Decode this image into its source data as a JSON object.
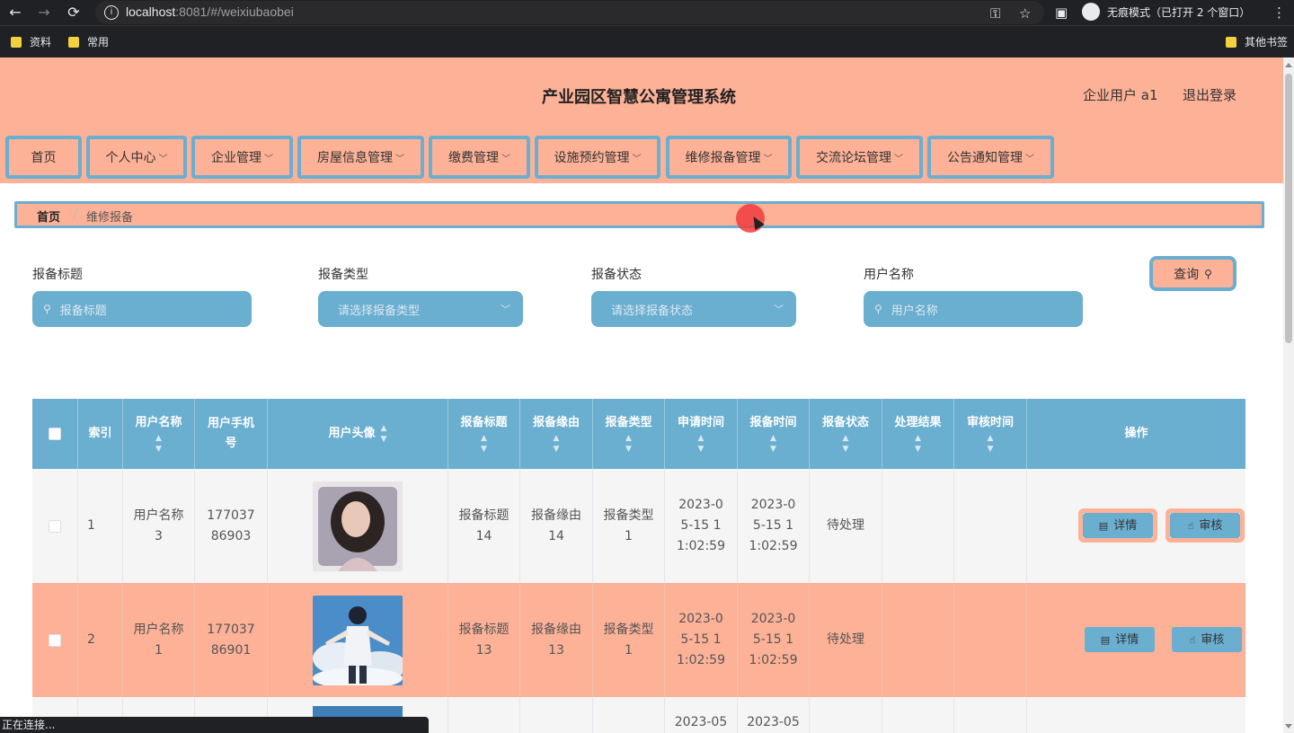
{
  "browser": {
    "url_host": "localhost",
    "url_rest": ":8081/#/weixiubaobei",
    "incognito_label": "无痕模式（已打开 2 个窗口）",
    "bookmarks": [
      "资料",
      "常用"
    ],
    "other_bookmarks": "其他书签",
    "status_text": "正在连接..."
  },
  "header": {
    "title": "产业园区智慧公寓管理系统",
    "user": "企业用户 a1",
    "logout": "退出登录"
  },
  "menu": [
    {
      "label": "首页"
    },
    {
      "label": "个人中心"
    },
    {
      "label": "企业管理"
    },
    {
      "label": "房屋信息管理"
    },
    {
      "label": "缴费管理"
    },
    {
      "label": "设施预约管理"
    },
    {
      "label": "维修报备管理"
    },
    {
      "label": "交流论坛管理"
    },
    {
      "label": "公告通知管理"
    }
  ],
  "breadcrumb": {
    "home": "首页",
    "current": "维修报备"
  },
  "search": {
    "title_label": "报备标题",
    "title_placeholder": "报备标题",
    "type_label": "报备类型",
    "type_placeholder": "请选择报备类型",
    "status_label": "报备状态",
    "status_placeholder": "请选择报备状态",
    "user_label": "用户名称",
    "user_placeholder": "用户名称",
    "query_button": "查询"
  },
  "table": {
    "headers": {
      "index": "索引",
      "username": "用户名称",
      "phone": "用户手机号",
      "avatar": "用户头像",
      "title": "报备标题",
      "reason": "报备缘由",
      "type": "报备类型",
      "apply_time": "申请时间",
      "report_time": "报备时间",
      "status": "报备状态",
      "result": "处理结果",
      "audit_time": "审核时间",
      "actions": "操作"
    },
    "rows": [
      {
        "index": "1",
        "username": "用户名称3",
        "phone": "17703786903",
        "title": "报备标题14",
        "reason": "报备缘由14",
        "type": "报备类型1",
        "apply_time": "2023-05-15 11:02:59",
        "report_time": "2023-05-15 11:02:59",
        "status": "待处理",
        "result": "",
        "audit_time": ""
      },
      {
        "index": "2",
        "username": "用户名称1",
        "phone": "17703786901",
        "title": "报备标题13",
        "reason": "报备缘由13",
        "type": "报备类型1",
        "apply_time": "2023-05-15 11:02:59",
        "report_time": "2023-05-15 11:02:59",
        "status": "待处理",
        "result": "",
        "audit_time": ""
      },
      {
        "index": "",
        "username": "",
        "phone": "",
        "title": "",
        "reason": "",
        "type": "",
        "apply_time": "2023-05",
        "report_time": "2023-05",
        "status": "",
        "result": "",
        "audit_time": ""
      }
    ],
    "detail_button": "详情",
    "audit_button": "审核"
  },
  "colors": {
    "accent_blue": "#6aaed0",
    "accent_salmon": "#fdb197"
  }
}
